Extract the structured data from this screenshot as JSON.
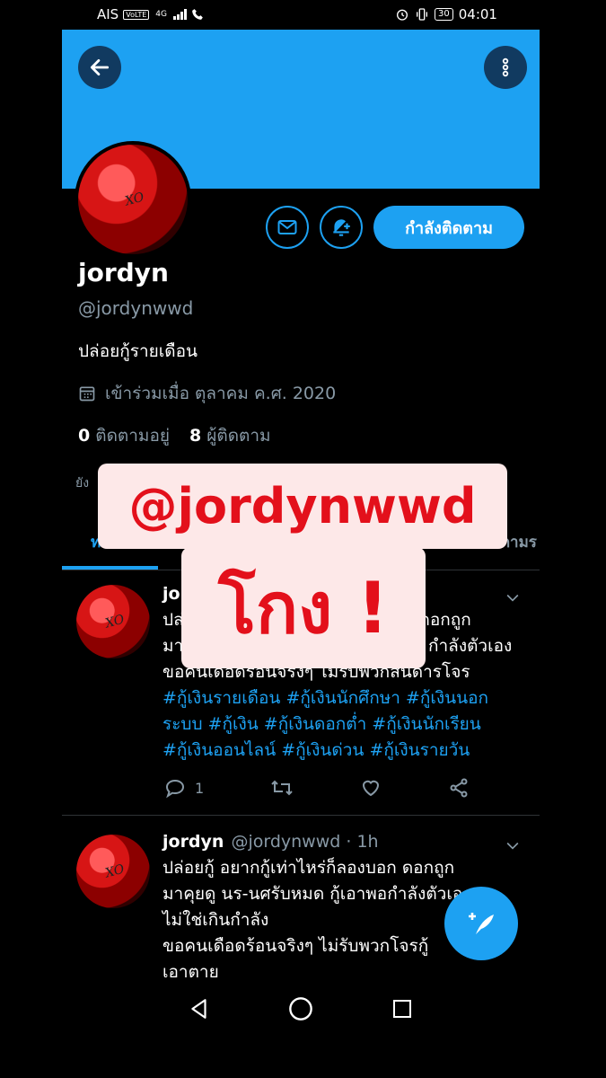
{
  "status_bar": {
    "carrier": "AIS",
    "volte": "VoLTE",
    "network": "4G",
    "battery": "30",
    "time": "04:01"
  },
  "profile": {
    "name": "jordyn",
    "handle": "@jordynwwd",
    "bio": "ปล่อยกู้รายเดือน",
    "joined": "เข้าร่วมเมื่อ ตุลาคม ค.ศ. 2020",
    "following_count": "0",
    "following_label": "ติดตามอยู่",
    "followers_count": "8",
    "followers_label": "ผู้ติดตาม",
    "following_button": "กำลังติดตาม",
    "not_followed_note": "ยัง"
  },
  "tabs": {
    "left": "ท",
    "right": "ตามร"
  },
  "overlay": {
    "line1": "@jordynwwd",
    "line2": "โกง !"
  },
  "tweets": [
    {
      "name": "jor",
      "lines": [
        "ปล่",
        "มา",
        "ขอคนเดือดร้อนจริงๆ ไม่รับพวกสันดารโจร"
      ],
      "line1_tail": "ก ดอกถูก",
      "line2_tail": "กำลังตัวเอง",
      "hashtags": [
        "#กู้เงินรายเดือน #กู้เงินนักศึกษา #กู้เงินนอก",
        "ระบบ #กู้เงิน #กู้เงินดอกต่ำ #กู้เงินนักเรียน",
        "#กู้เงินออนไลน์ #กู้เงินด่วน #กู้เงินรายวัน"
      ],
      "reply_count": "1"
    },
    {
      "name": "jordyn",
      "meta": "@jordynwwd · 1h",
      "lines": [
        "ปล่อยกู้ อยากกู้เท่าไหร่ก็ลองบอก ดอกถูก",
        "มาคุยดู นร-นศรับหมด กู้เอาพอกำลังตัวเอง",
        "ไม่ใช่เกินกำลัง",
        "ขอคนเดือดร้อนจริงๆ ไม่รับพวกโจรกู้",
        "เอาตาย"
      ]
    }
  ],
  "colors": {
    "accent": "#1da1f2",
    "overlay_text": "#e3101b",
    "overlay_bg": "#fde8e8",
    "muted": "#8899a6"
  }
}
